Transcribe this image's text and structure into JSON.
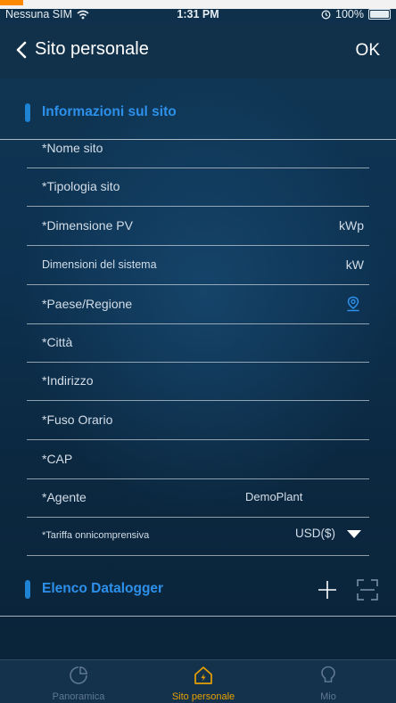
{
  "status_bar": {
    "carrier": "Nessuna SIM",
    "time": "1:31 PM",
    "battery_text": "100%"
  },
  "nav": {
    "back_label": "Sito personale",
    "ok_label": "OK"
  },
  "sections": {
    "site_info_title": "Informazioni sul sito",
    "datalogger_title": "Elenco Datalogger"
  },
  "fields": [
    {
      "label": "*Nome sito"
    },
    {
      "label": "*Tipologia sito"
    },
    {
      "label": "*Dimensione PV",
      "unit": "kWp"
    },
    {
      "label": "Dimensioni del sistema",
      "unit": "kW"
    },
    {
      "label": "*Paese/Regione",
      "icon": "location-icon"
    },
    {
      "label": "*Città"
    },
    {
      "label": "*Indirizzo"
    },
    {
      "label": "*Fuso Orario"
    },
    {
      "label": "*CAP"
    },
    {
      "label": "*Agente",
      "value": "DemoPlant"
    },
    {
      "label": "*Tariffa onnicomprensiva",
      "value": "USD($)",
      "icon": "dropdown-triangle-icon"
    }
  ],
  "tabs": [
    {
      "label": "Panoramica",
      "icon": "pie-chart-icon",
      "active": false
    },
    {
      "label": "Sito personale",
      "icon": "home-icon",
      "active": true
    },
    {
      "label": "Mio",
      "icon": "bulb-icon",
      "active": false
    }
  ],
  "colors": {
    "accent": "#2d90ea",
    "active_tab": "#e6a100",
    "background": "#0d3150"
  }
}
